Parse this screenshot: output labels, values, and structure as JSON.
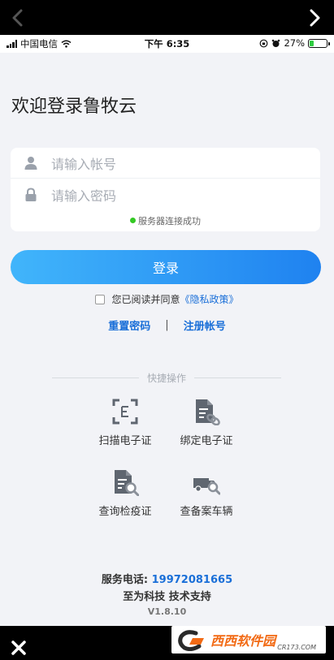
{
  "status_bar": {
    "carrier": "中国电信",
    "time": "下午 6:35",
    "battery": "27%",
    "battery_level": 0.27
  },
  "login": {
    "title": "欢迎登录鲁牧云",
    "account_placeholder": "请输入帐号",
    "password_placeholder": "请输入密码",
    "connection_status": "服务器连接成功",
    "login_button": "登录",
    "agree_text": "您已阅读并同意",
    "privacy_policy": "《隐私政策》",
    "reset_password": "重置密码",
    "separator": "|",
    "register": "注册帐号"
  },
  "quick_actions": {
    "header": "快捷操作",
    "items": [
      {
        "label": "扫描电子证",
        "icon": "scan-e-cert-icon"
      },
      {
        "label": "绑定电子证",
        "icon": "bind-cert-icon"
      },
      {
        "label": "查询检疫证",
        "icon": "search-cert-icon"
      },
      {
        "label": "查备案车辆",
        "icon": "search-truck-icon"
      }
    ]
  },
  "footer": {
    "service_label": "服务电话:",
    "service_phone": "19972081665",
    "support": "至为科技 技术支持",
    "version": "V1.8.10"
  },
  "watermark": {
    "brand": "西西软件园",
    "url": "CR173.COM"
  },
  "colors": {
    "accent": "#1a6fd8",
    "button_start": "#41b5fb",
    "button_end": "#1f82f0",
    "status_ok": "#34c924",
    "background": "#f2f3f7"
  }
}
